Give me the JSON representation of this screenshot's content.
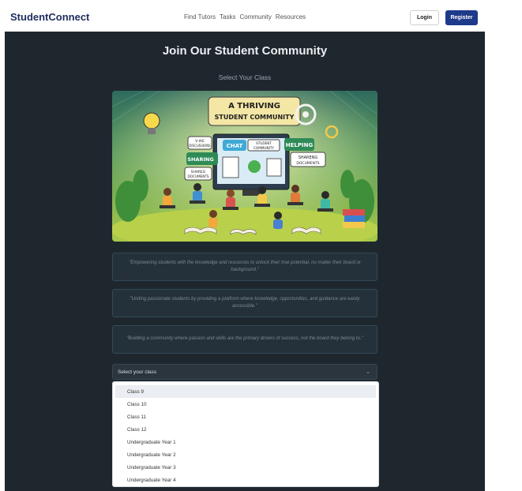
{
  "navbar": {
    "brand": "StudentConnect",
    "links": [
      "Find Tutors",
      "Tasks",
      "Community",
      "Resources"
    ],
    "login_label": "Login",
    "register_label": "Register"
  },
  "main": {
    "title": "Join Our Student Community",
    "subtitle": "Select Your Class",
    "hero": {
      "banner": "A THRIVING STUDENT COMMUNITY",
      "bubbles": [
        "V-IAE DISCUSSIONS",
        "CHAT",
        "STUDENT COMMUNITY",
        "HELPING",
        "SHARING",
        "SHARENG DOCUMENTS",
        "SHAREG DOCUMENTS"
      ]
    },
    "quotes": [
      "\"Empowering students with the knowledge and resources to unlock their true potential, no matter their board or background.\"",
      "\"Uniting passionate students by providing a platform where knowledge, opportunities, and guidance are easily accessible.\"",
      "\"Building a community where passion and skills are the primary drivers of success, not the board they belong to.\""
    ],
    "select": {
      "placeholder": "Select your class",
      "options": [
        "Class 9",
        "Class 10",
        "Class 11",
        "Class 12",
        "Undergraduate Year 1",
        "Undergraduate Year 2",
        "Undergraduate Year 3",
        "Undergraduate Year 4"
      ]
    }
  },
  "colors": {
    "brand": "#1f2d5c",
    "accent": "#1e3a8a",
    "background": "#1f272e"
  }
}
